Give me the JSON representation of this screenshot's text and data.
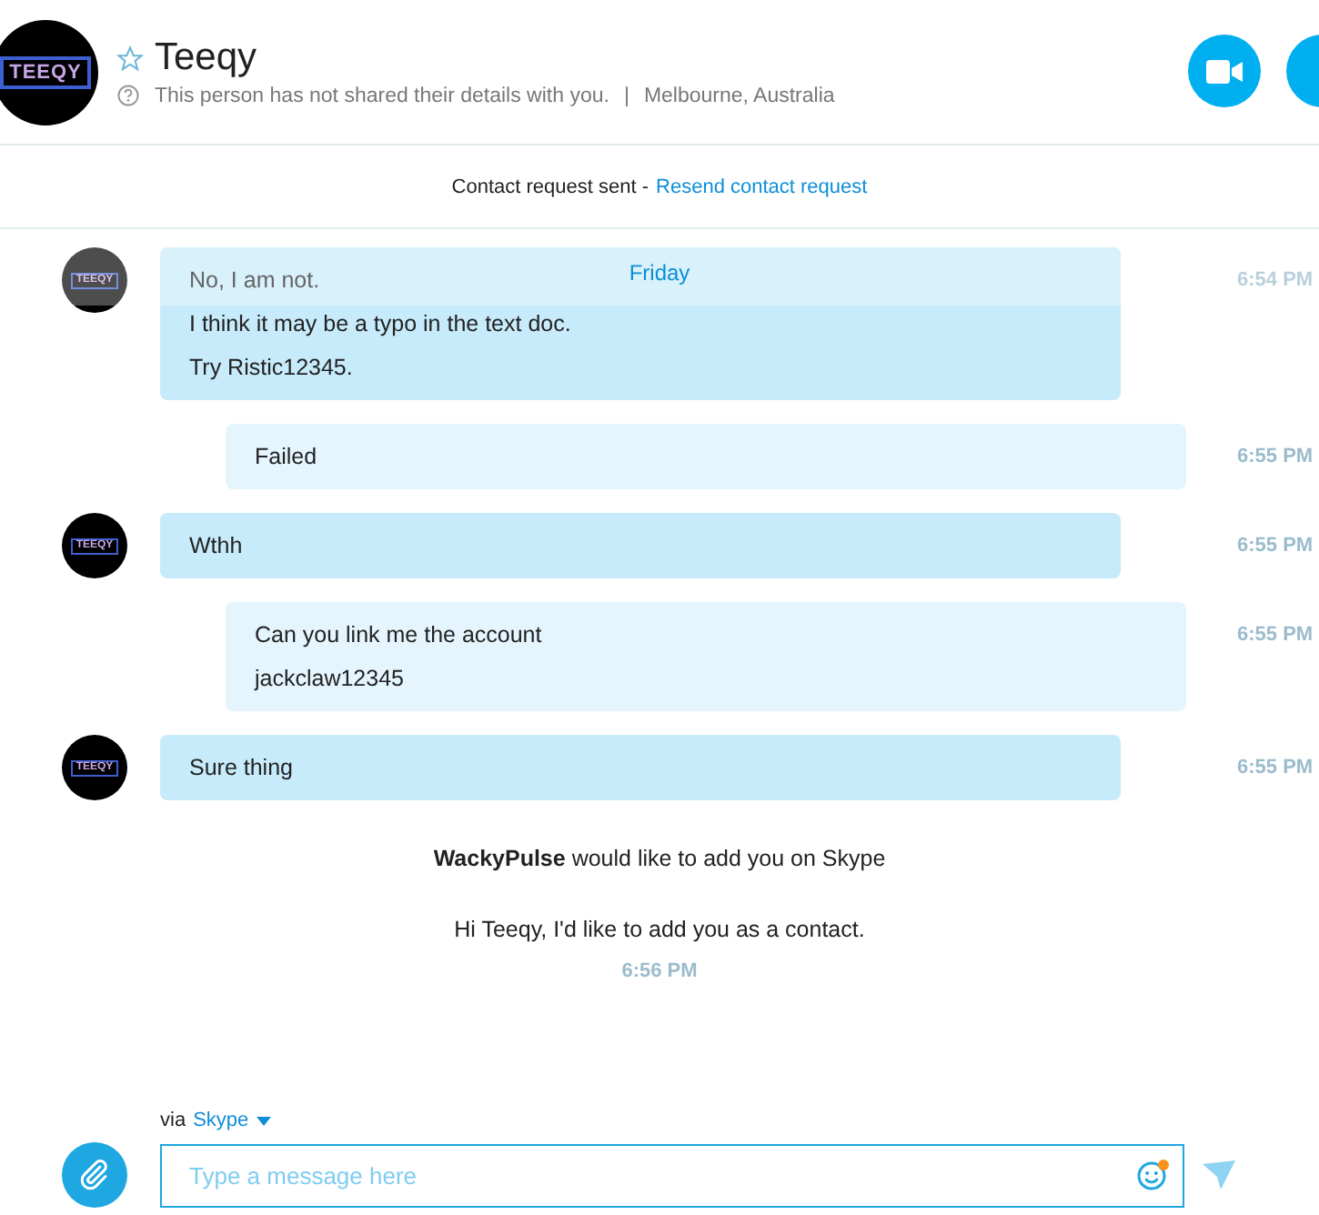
{
  "contact": {
    "name": "Teeqy",
    "logo_text": "TEEQY",
    "favorite": false,
    "status_text": "This person has not shared their details with you.",
    "separator": "|",
    "location": "Melbourne, Australia"
  },
  "request_bar": {
    "text": "Contact request sent -",
    "link": "Resend contact request"
  },
  "date_divider": "Friday",
  "messages": [
    {
      "kind": "incoming",
      "avatar_text": "TEEQY",
      "lines": [
        "No, I am not.",
        "I think it may be a typo in the text doc.",
        "Try Ristic12345."
      ],
      "time": "6:54 PM"
    },
    {
      "kind": "outgoing",
      "lines": [
        "Failed"
      ],
      "time": "6:55 PM"
    },
    {
      "kind": "incoming",
      "avatar_text": "TEEQY",
      "lines": [
        "Wthh"
      ],
      "time": "6:55 PM"
    },
    {
      "kind": "outgoing",
      "lines": [
        "Can you link me the account",
        "jackclaw12345"
      ],
      "time": "6:55 PM"
    },
    {
      "kind": "incoming",
      "avatar_text": "TEEQY",
      "lines": [
        "Sure thing"
      ],
      "time": "6:55 PM"
    }
  ],
  "contact_request": {
    "title": "**WackyPulse** would like to add you on Skype",
    "message": "Hi Teeqy, I'd like to add you as a contact.",
    "time": "6:56 PM"
  },
  "composer": {
    "via_label": "via",
    "via_service": "Skype",
    "placeholder": "Type a message here",
    "emoji_notification": true
  }
}
